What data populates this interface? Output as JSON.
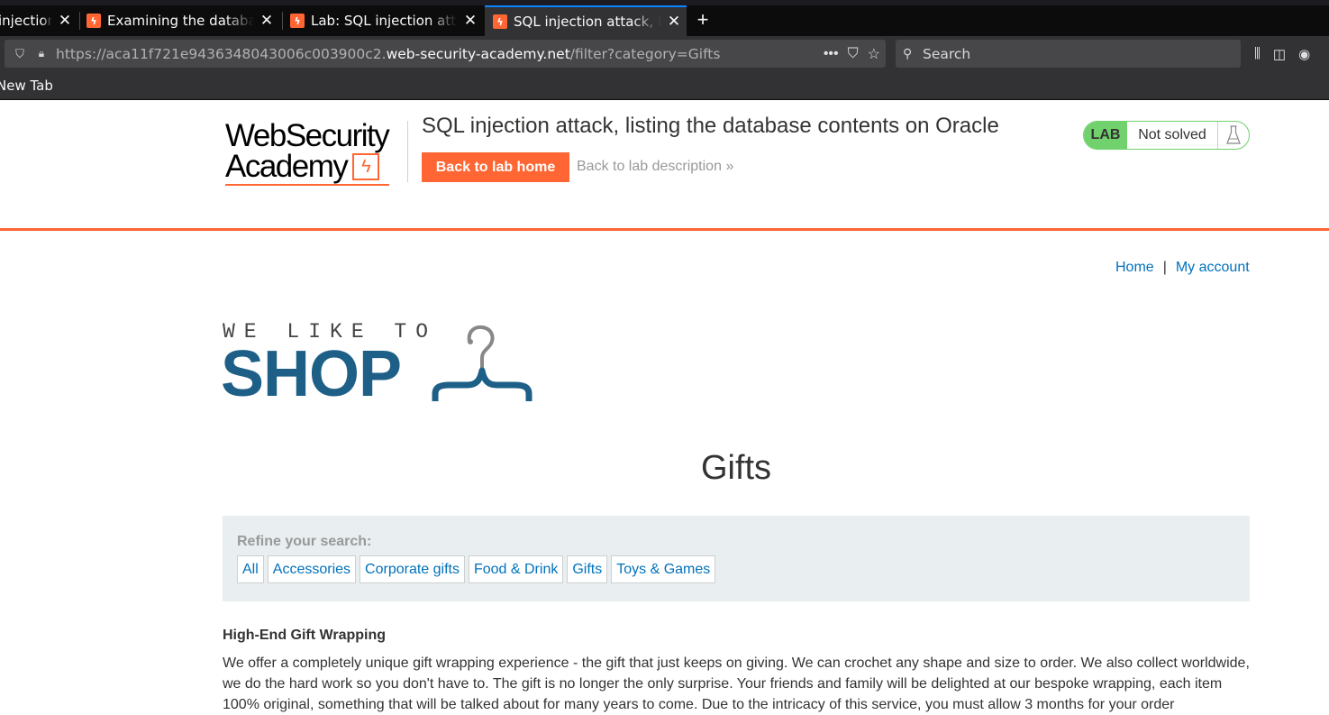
{
  "browser": {
    "tabs": [
      {
        "label": "injection?",
        "active": false
      },
      {
        "label": "Examining the database",
        "active": false
      },
      {
        "label": "Lab: SQL injection attack",
        "active": false
      },
      {
        "label": "SQL injection attack, listing",
        "active": true
      }
    ],
    "url_prefix": "https://aca11f721e9436348043006c003900c2.",
    "url_host": "web-security-academy.net",
    "url_path": "/filter?category=Gifts",
    "search_placeholder": "Search",
    "bookmark": "New Tab"
  },
  "academy": {
    "logo_line1": "WebSecurity",
    "logo_line2": "Academy",
    "lab_title": "SQL injection attack, listing the database contents on Oracle",
    "back_home": "Back to lab home",
    "back_desc": "Back to lab description",
    "badge_lab": "LAB",
    "badge_status": "Not solved",
    "accent": "#ff6633",
    "lab_green": "#70d16d"
  },
  "shop": {
    "nav": {
      "home": "Home",
      "sep": "|",
      "account": "My account"
    },
    "logo_top": "WE LIKE TO",
    "logo_main": "SHOP",
    "category_heading": "Gifts",
    "refine_label": "Refine your search:",
    "categories": [
      "All",
      "Accessories",
      "Corporate gifts",
      "Food & Drink",
      "Gifts",
      "Toys & Games"
    ],
    "product_title": "High-End Gift Wrapping",
    "product_desc": "We offer a completely unique gift wrapping experience - the gift that just keeps on giving. We can crochet any shape and size to order. We also collect worldwide, we do the hard work so you don't have to. The gift is no longer the only surprise. Your friends and family will be delighted at our bespoke wrapping, each item 100% original, something that will be talked about for many years to come. Due to the intricacy of this service, you must allow 3 months for your order",
    "link_color": "#0071bc",
    "brand_blue": "#1d5f86"
  }
}
